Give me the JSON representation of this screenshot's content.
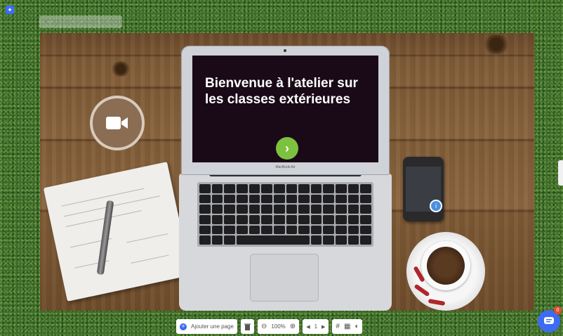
{
  "editor": {
    "audio_button_label": "Ajouter un audio de fond",
    "page_counter": "1",
    "zoom_level": "100%",
    "add_page_label": "Ajouter une page"
  },
  "slide": {
    "title": "Bienvenue à l'atelier sur les classes extérieures",
    "laptop_brand": "MacBook Air",
    "phone_pin_label": "i"
  },
  "chat": {
    "badge_count": "0"
  },
  "colors": {
    "accent": "#3d6bf2",
    "next_button": "#7cc23f",
    "video_button": "#8a6d52",
    "badge": "#e84a2a"
  }
}
